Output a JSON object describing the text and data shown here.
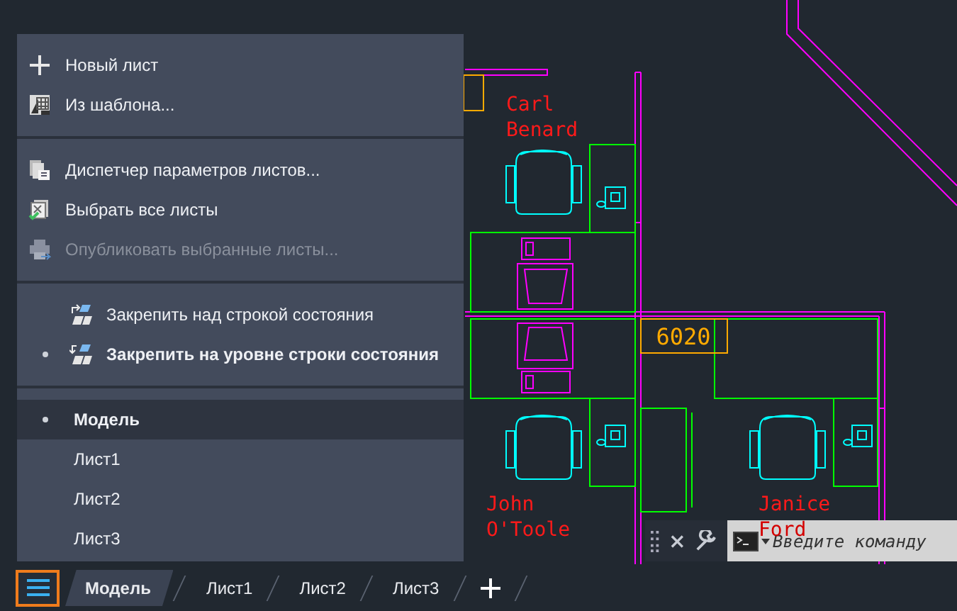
{
  "menu": {
    "sections": [
      {
        "items": [
          {
            "kind": "new",
            "label": "Новый лист",
            "disabled": false
          },
          {
            "kind": "template",
            "label": "Из шаблона...",
            "disabled": false
          }
        ]
      },
      {
        "items": [
          {
            "kind": "setup",
            "label": "Диспетчер параметров листов...",
            "disabled": false
          },
          {
            "kind": "selectall",
            "label": "Выбрать все листы",
            "disabled": false
          },
          {
            "kind": "publish",
            "label": "Опубликовать выбранные листы...",
            "disabled": true
          }
        ]
      },
      {
        "items": [
          {
            "kind": "dockabove",
            "label": "Закрепить над строкой состояния",
            "selected": false
          },
          {
            "kind": "dockinline",
            "label": "Закрепить на уровне строки состояния",
            "selected": true
          }
        ]
      },
      {
        "items": [
          {
            "kind": "layout",
            "label": "Модель",
            "selected": true
          },
          {
            "kind": "layout",
            "label": "Лист1",
            "selected": false
          },
          {
            "kind": "layout",
            "label": "Лист2",
            "selected": false
          },
          {
            "kind": "layout",
            "label": "Лист3",
            "selected": false
          }
        ]
      }
    ]
  },
  "drawing": {
    "occupants": [
      {
        "first": "Carl",
        "last": "Benard"
      },
      {
        "first": "John",
        "last": "O'Toole"
      },
      {
        "first": "Janice",
        "last": "Ford"
      }
    ],
    "room_number": "6020"
  },
  "command_line": {
    "placeholder": "Введите команду"
  },
  "layout_tabs": [
    {
      "label": "Модель",
      "selected": true
    },
    {
      "label": "Лист1",
      "selected": false
    },
    {
      "label": "Лист2",
      "selected": false
    },
    {
      "label": "Лист3",
      "selected": false
    }
  ]
}
